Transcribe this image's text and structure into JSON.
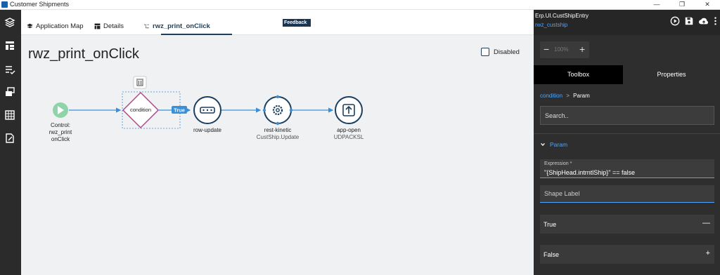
{
  "window": {
    "title": "Customer Shipments",
    "controls": {
      "minimize": "—",
      "restore": "❐",
      "close": "✕"
    }
  },
  "feedback_label": "Feedback",
  "tabs": [
    {
      "label": "Application Map",
      "icon": "layers-icon"
    },
    {
      "label": "Details",
      "icon": "table-icon"
    },
    {
      "label": "rwz_print_onClick",
      "icon": "flow-icon",
      "active": true
    }
  ],
  "canvas": {
    "title": "rwz_print_onClick",
    "disabled_label": "Disabled",
    "disabled_checked": false,
    "nodes": [
      {
        "type": "event",
        "label_lines": [
          "Control:",
          "rwz_print",
          "onClick"
        ],
        "color": "#8fd3a9"
      },
      {
        "type": "condition",
        "label": "condition",
        "color": "#b04a88"
      },
      {
        "type": "row-update",
        "label": "row-update",
        "sub": ""
      },
      {
        "type": "rest-kinetic",
        "label": "rest-kinetic",
        "sub": "CustShip.Update"
      },
      {
        "type": "app-open",
        "label": "app-open",
        "sub": "UDPACKSL"
      }
    ],
    "edge_label_true": "True"
  },
  "right_panel": {
    "title": "Erp.UI.CustShipEntry",
    "subtitle": "rwz_custship",
    "zoom": {
      "minus": "−",
      "value": "100%",
      "plus": "+"
    },
    "tabs": {
      "toolbox": "Toolbox",
      "properties": "Properties"
    },
    "breadcrumb": {
      "link": "condition",
      "separator": ">",
      "current": "Param"
    },
    "search_placeholder": "Search..",
    "section": "Param",
    "expression": {
      "label": "Expression *",
      "value": "\"{ShipHead.intrntlShip}\" == false"
    },
    "shape_label_placeholder": "Shape Label",
    "groups": [
      {
        "label": "True",
        "symbol": "—"
      },
      {
        "label": "False",
        "symbol": "+"
      }
    ]
  },
  "colors": {
    "accent": "#4ea6ff",
    "navy": "#1d3f5e",
    "flow_line": "#3a8fd6",
    "condition": "#b04a88"
  }
}
